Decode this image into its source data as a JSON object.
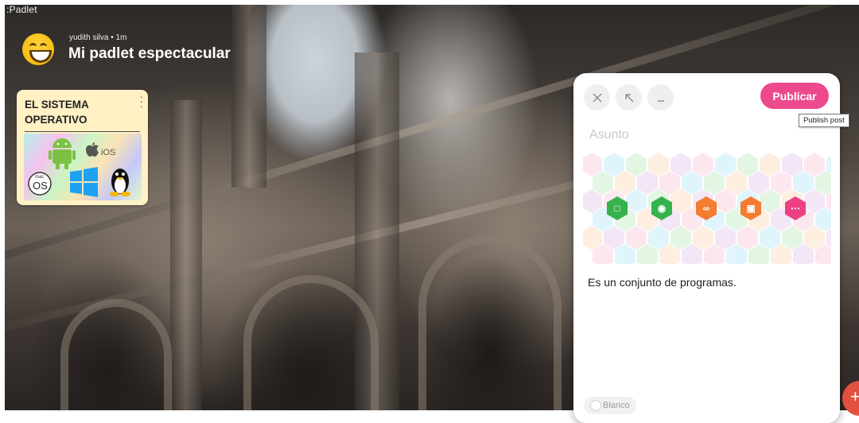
{
  "app": {
    "logo_text": ":Padlet"
  },
  "header": {
    "author_line": "yudith silva • 1m",
    "title": "Mi padlet espectacular",
    "avatar_icon": "grinning-emoji-icon"
  },
  "post_card": {
    "title": "EL SISTEMA OPERATIVO",
    "menu_icon": "vertical-dots-icon",
    "image_logos": {
      "android": "android-logo-icon",
      "ios_label": "iOS",
      "macos_small": "mac",
      "macos_big": "OS",
      "windows": "windows-logo-icon",
      "linux": "tux-penguin-icon"
    }
  },
  "composer": {
    "close_icon": "close-icon",
    "expand_icon": "arrow-up-left-icon",
    "minimize_icon": "minimize-icon",
    "publish_label": "Publicar",
    "publish_tooltip": "Publish post",
    "subject_placeholder": "Asunto",
    "attachments": [
      {
        "icon": "upload-file-icon",
        "color": "#36b24a"
      },
      {
        "icon": "camera-icon",
        "color": "#36b24a"
      },
      {
        "icon": "link-icon",
        "color": "#f47b30"
      },
      {
        "icon": "image-search-icon",
        "color": "#f47b30"
      },
      {
        "icon": "more-icon",
        "color": "#ec3f84"
      }
    ],
    "body_text": "Es un conjunto de programas.",
    "color_option": "Blanco"
  },
  "colors": {
    "publish": "#ec4a8c",
    "card": "#fff1c4",
    "fab": "#e2503f"
  },
  "fab_icon": "plus-icon"
}
